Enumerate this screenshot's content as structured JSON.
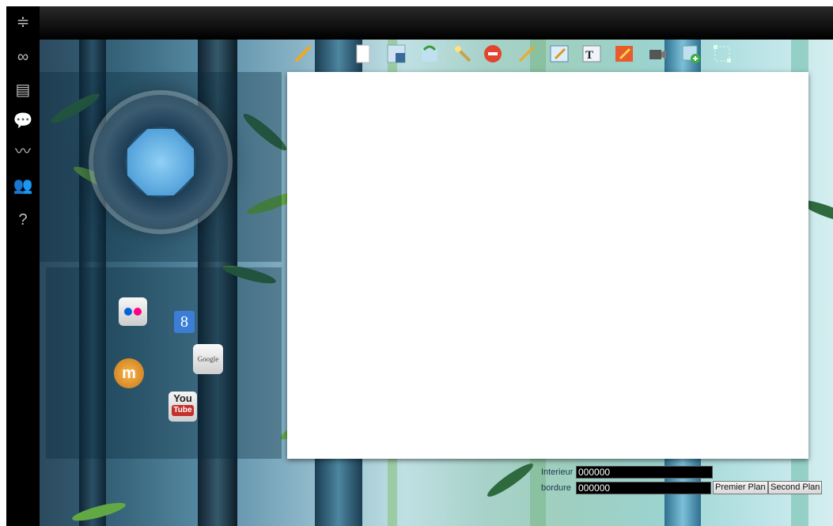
{
  "sidebar": {
    "items": [
      {
        "name": "signpost-icon",
        "glyph": "≑"
      },
      {
        "name": "infinity-icon",
        "glyph": "∞"
      },
      {
        "name": "notepad-icon",
        "glyph": "▤"
      },
      {
        "name": "chat-icon",
        "glyph": "💬"
      },
      {
        "name": "chart-icon",
        "glyph": "〰"
      },
      {
        "name": "users-icon",
        "glyph": "👥"
      },
      {
        "name": "help-icon",
        "glyph": "?"
      }
    ]
  },
  "toolbar": {
    "tools": [
      "pencil-tool-icon",
      "new-page-icon",
      "save-icon",
      "rotate-icon",
      "wand-icon",
      "stop-icon",
      "pen-icon",
      "edit-frame-icon",
      "text-tool-icon",
      "fill-tool-icon",
      "video-icon",
      "add-image-icon",
      "select-tool-icon"
    ]
  },
  "apps": [
    "flickr-icon",
    "google-plus-icon",
    "moodle-icon",
    "google-icon",
    "youtube-icon"
  ],
  "fields": {
    "interieur": {
      "label": "Interieur",
      "value": "000000"
    },
    "bordure": {
      "label": "bordure",
      "value": "000000"
    }
  },
  "buttons": {
    "premier_plan": "Premier Plan",
    "second_plan": "Second Plan"
  },
  "app_labels": {
    "youtube_top": "You",
    "youtube_bottom": "Tube",
    "google": "Google",
    "google_plus": "8",
    "moodle": "m"
  }
}
